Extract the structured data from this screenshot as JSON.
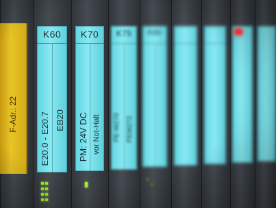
{
  "modules": {
    "left": {
      "label": "F-Adr.: 22"
    },
    "k60": {
      "header": "K60",
      "col1": "E20.0 - E20.7",
      "col2": "EB20"
    },
    "k70": {
      "header": "K70",
      "col1": "PM: 24V DC",
      "col2": "vor Not-Halt"
    },
    "k75": {
      "header": "K75",
      "col1": "PE-W270",
      "col2": "PEW272"
    },
    "k80": {
      "header": "K80"
    }
  },
  "colors": {
    "strip": "#7ee4ee",
    "yellow_module": "#e2bd22",
    "status_led": "#a6f22a",
    "fault_led": "#ff3a3a"
  }
}
